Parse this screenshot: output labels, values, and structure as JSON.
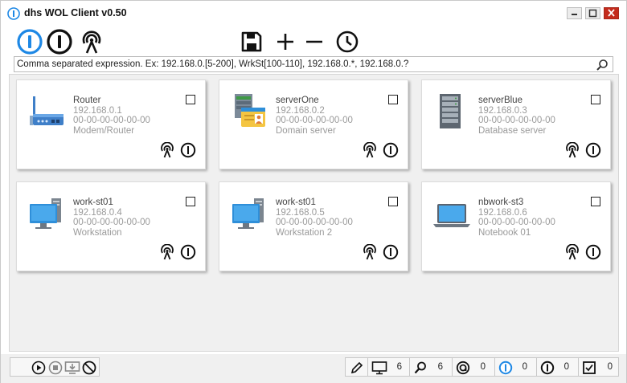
{
  "window": {
    "title": "dhs WOL Client v0.50"
  },
  "search": {
    "placeholder": "Comma separated expression. Ex: 192.168.0.[5-200], WrkSt[100-110], 192.168.0.*, 192.168.0.?"
  },
  "colors": {
    "accent": "#1e88e5",
    "close_button": "#c42b1c",
    "icon_dark": "#111111"
  },
  "toolbar": {
    "icons": [
      "power-on-icon",
      "power-off-icon",
      "broadcast-icon",
      "save-icon",
      "plus-icon",
      "minus-icon",
      "clock-icon"
    ]
  },
  "devices": [
    {
      "name": "Router",
      "ip": "192.168.0.1",
      "mac": "00-00-00-00-00-00",
      "type": "Modem/Router",
      "icon": "router-icon",
      "checked": false
    },
    {
      "name": "serverOne",
      "ip": "192.168.0.2",
      "mac": "00-00-00-00-00-00",
      "type": "Domain server",
      "icon": "domain-server-icon",
      "checked": false
    },
    {
      "name": "serverBlue",
      "ip": "192.168.0.3",
      "mac": "00-00-00-00-00-00",
      "type": "Database server",
      "icon": "database-server-icon",
      "checked": false
    },
    {
      "name": "work-st01",
      "ip": "192.168.0.4",
      "mac": "00-00-00-00-00-00",
      "type": "Workstation",
      "icon": "workstation-icon",
      "checked": false
    },
    {
      "name": "work-st01",
      "ip": "192.168.0.5",
      "mac": "00-00-00-00-00-00",
      "type": "Workstation 2",
      "icon": "workstation-icon",
      "checked": false
    },
    {
      "name": "nbwork-st3",
      "ip": "192.168.0.6",
      "mac": "00-00-00-00-00-00",
      "type": "Notebook 01",
      "icon": "notebook-icon",
      "checked": false
    }
  ],
  "statusbar": {
    "left_icons": [
      "play-icon",
      "stop-icon",
      "download-monitor-icon",
      "cancel-icon"
    ],
    "counters": {
      "computers": "6",
      "found": "6",
      "pinged": "0",
      "online": "0",
      "offline": "0",
      "selected": "0"
    }
  }
}
